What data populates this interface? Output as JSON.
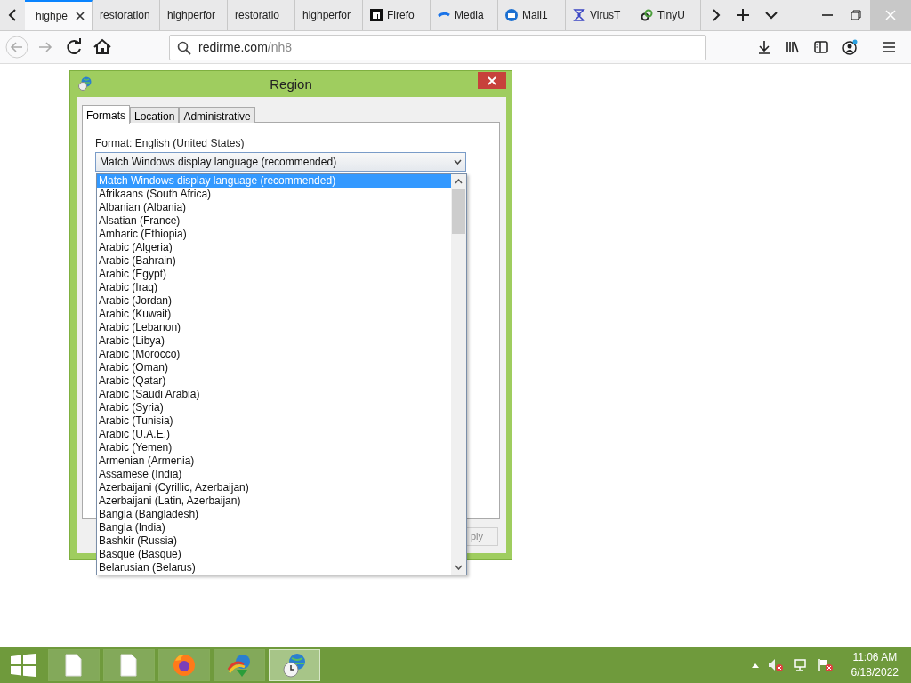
{
  "browser": {
    "tabs": [
      {
        "title": "highpe",
        "selected": true
      },
      {
        "title": "restoration",
        "selected": false
      },
      {
        "title": "highperfor",
        "selected": false
      },
      {
        "title": "restoratio",
        "selected": false
      },
      {
        "title": "highperfor",
        "selected": false
      },
      {
        "title": "Firefo",
        "selected": false
      },
      {
        "title": "Media",
        "selected": false
      },
      {
        "title": "Mail1",
        "selected": false
      },
      {
        "title": "VirusT",
        "selected": false
      },
      {
        "title": "TinyU",
        "selected": false
      }
    ],
    "address": {
      "host": "redirme.com",
      "path": "/nh8"
    }
  },
  "dialog": {
    "title": "Region",
    "tabs": [
      {
        "label": "Formats",
        "selected": true
      },
      {
        "label": "Location",
        "selected": false
      },
      {
        "label": "Administrative",
        "selected": false
      }
    ],
    "format_label": "Format: English (United States)",
    "format_value": "Match Windows display language (recommended)",
    "options": [
      {
        "label": "Match Windows display language (recommended)",
        "selected": true
      },
      {
        "label": "Afrikaans (South Africa)",
        "selected": false
      },
      {
        "label": "Albanian (Albania)",
        "selected": false
      },
      {
        "label": "Alsatian (France)",
        "selected": false
      },
      {
        "label": "Amharic (Ethiopia)",
        "selected": false
      },
      {
        "label": "Arabic (Algeria)",
        "selected": false
      },
      {
        "label": "Arabic (Bahrain)",
        "selected": false
      },
      {
        "label": "Arabic (Egypt)",
        "selected": false
      },
      {
        "label": "Arabic (Iraq)",
        "selected": false
      },
      {
        "label": "Arabic (Jordan)",
        "selected": false
      },
      {
        "label": "Arabic (Kuwait)",
        "selected": false
      },
      {
        "label": "Arabic (Lebanon)",
        "selected": false
      },
      {
        "label": "Arabic (Libya)",
        "selected": false
      },
      {
        "label": "Arabic (Morocco)",
        "selected": false
      },
      {
        "label": "Arabic (Oman)",
        "selected": false
      },
      {
        "label": "Arabic (Qatar)",
        "selected": false
      },
      {
        "label": "Arabic (Saudi Arabia)",
        "selected": false
      },
      {
        "label": "Arabic (Syria)",
        "selected": false
      },
      {
        "label": "Arabic (Tunisia)",
        "selected": false
      },
      {
        "label": "Arabic (U.A.E.)",
        "selected": false
      },
      {
        "label": "Arabic (Yemen)",
        "selected": false
      },
      {
        "label": "Armenian (Armenia)",
        "selected": false
      },
      {
        "label": "Assamese (India)",
        "selected": false
      },
      {
        "label": "Azerbaijani (Cyrillic, Azerbaijan)",
        "selected": false
      },
      {
        "label": "Azerbaijani (Latin, Azerbaijan)",
        "selected": false
      },
      {
        "label": "Bangla (Bangladesh)",
        "selected": false
      },
      {
        "label": "Bangla (India)",
        "selected": false
      },
      {
        "label": "Bashkir (Russia)",
        "selected": false
      },
      {
        "label": "Basque (Basque)",
        "selected": false
      },
      {
        "label": "Belarusian (Belarus)",
        "selected": false
      }
    ],
    "apply_button": "ply"
  },
  "taskbar": {
    "buttons": [
      {
        "selected": false
      },
      {
        "selected": false
      },
      {
        "selected": false
      },
      {
        "selected": false
      },
      {
        "selected": true
      }
    ],
    "time": "11:06 AM",
    "date": "6/18/2022"
  }
}
